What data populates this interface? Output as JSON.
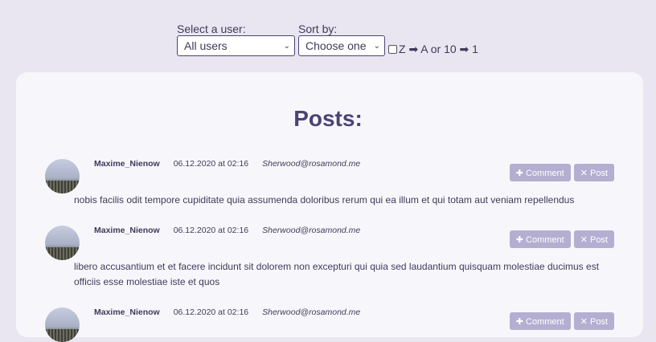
{
  "filters": {
    "user_label": "Select a user:",
    "user_value": "All users",
    "sort_label": "Sort by:",
    "sort_value": "Choose one",
    "reverse_label": "Z ➡ A or 10 ➡ 1",
    "reverse_checked": false
  },
  "posts_title": "Posts:",
  "posts": [
    {
      "author": "Maxime_Nienow",
      "date": "06.12.2020 at 02:16",
      "email": "Sherwood@rosamond.me",
      "body": "nobis facilis odit tempore cupiditate quia assumenda doloribus rerum qui ea illum et qui totam aut veniam repellendus",
      "comment_label": "✚ Comment",
      "delete_label": "✕ Post"
    },
    {
      "author": "Maxime_Nienow",
      "date": "06.12.2020 at 02:16",
      "email": "Sherwood@rosamond.me",
      "body": "libero accusantium et et facere incidunt sit dolorem non excepturi qui quia sed laudantium quisquam molestiae ducimus est officiis esse molestiae iste et quos",
      "comment_label": "✚ Comment",
      "delete_label": "✕ Post"
    },
    {
      "author": "Maxime_Nienow",
      "date": "06.12.2020 at 02:16",
      "email": "Sherwood@rosamond.me",
      "body": "",
      "comment_label": "✚ Comment",
      "delete_label": "✕ Post"
    }
  ]
}
